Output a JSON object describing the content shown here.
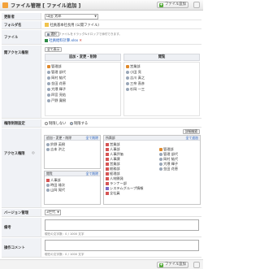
{
  "header": {
    "title": "ファイル管理 [ ファイル追加 ]",
    "add_button": "ファイル追加",
    "close_icon": "close-icon"
  },
  "fields": {
    "updater_label": "更新者",
    "updater_value": "山田 太郎",
    "folder_label": "フォルダ名",
    "folder_value": "社員基本社長用 (公開ファイル)",
    "file_label": "ファイル",
    "file_button": "選択",
    "file_hint": "ファイルをドラッグ&ドロップで添付できます。",
    "file_name": "社員給料計算.xlsx",
    "browse_access_label": "閲アクセス権限",
    "all_display_button": "全て表示",
    "browse_left_head": "追加・変更・削除",
    "browse_right_head": "閲覧",
    "browse_left_items": [
      "管理部",
      "管理 部代",
      "岡村 紘代",
      "金田 花恵",
      "大隈 輝子",
      "四宮 亮佑",
      "戸野 寛樹"
    ],
    "browse_right_items": [
      "営業部",
      "小田 亮",
      "吉川 真之",
      "三奈 直彦",
      "杉岡 一三"
    ],
    "inherit_label": "権限制限設定",
    "radio_no": "制限しない",
    "radio_yes": "制限する",
    "detail_button": "詳細検索",
    "access_label": "アクセス権限",
    "access_tl_head": "追加・変更・削除",
    "access_tl_all": "全て削除",
    "access_tl_items": [
      "鈴野 英樹",
      "吉本 洪之"
    ],
    "access_bl_head": "閲覧",
    "access_bl_all": "全て削除",
    "access_bl_items": [
      "人事部",
      "時田 雄次",
      "山岡 晃代"
    ],
    "access_right_head": "所属部",
    "access_right_all": "全て追加",
    "access_right_items": [
      "営業部",
      "人事部",
      "人事評価",
      "人事課",
      "営業部",
      "総務部",
      "経理部",
      "人材開発",
      "ランナー部",
      "システムグループ情報",
      "全社員"
    ],
    "access_right_users": [
      "管理部",
      "管理 部代",
      "岡村 紘代",
      "大隈 輝子",
      "金田 花恵"
    ],
    "version_label": "バージョン管理",
    "version_value": "3世代",
    "remarks_label": "備考",
    "remarks_counter": "現在の文字数：0 / 1000 文字",
    "comment_label": "操作コメント",
    "comment_counter": "現在の文字数：0 / 1000 文字"
  },
  "colors": {
    "accent_green": "#56a93b",
    "label_bg": "#f0f2f6",
    "link_blue": "#1a56b8"
  }
}
